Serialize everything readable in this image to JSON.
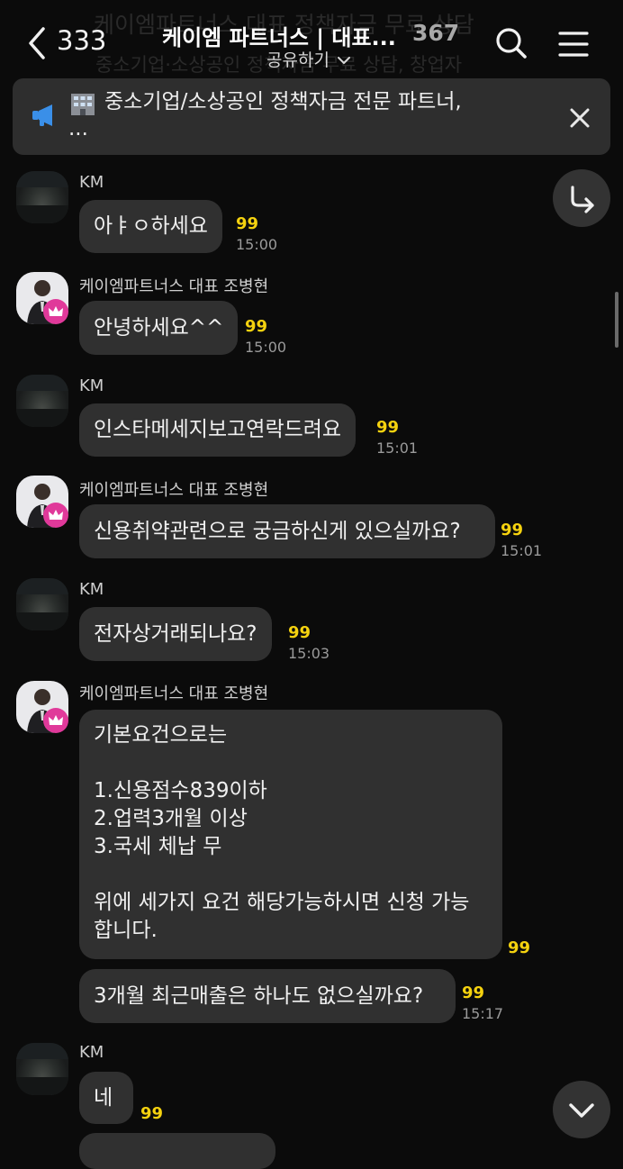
{
  "header": {
    "back_count": "333",
    "title": "케이엠 파트너스 | 대표...",
    "member_count": "367",
    "share_label": "공유하기",
    "bg_title_ghost": "케이엠파트너스 대표 정책자금 무료 상담",
    "bg_subtitle_ghost": "중소기업·소상공인 정책자금 무료 상담, 창업자"
  },
  "notice": {
    "line1": "중소기업/소상공인 정책자금 전문 파트너,",
    "line2": "..."
  },
  "messages": [
    {
      "sender": "KM",
      "text": "아ㅑㅇ하세요",
      "read": "99",
      "time": "15:00"
    },
    {
      "sender": "케이엠파트너스 대표 조병현",
      "text": "안녕하세요^^",
      "read": "99",
      "time": "15:00"
    },
    {
      "sender": "KM",
      "text": "인스타메세지보고연락드려요",
      "read": "99",
      "time": "15:01"
    },
    {
      "sender": "케이엠파트너스 대표 조병현",
      "text": "신용취약관련으로 궁금하신게 있으실까요?",
      "read": "99",
      "time": "15:01"
    },
    {
      "sender": "KM",
      "text": "전자상거래되나요?",
      "read": "99",
      "time": "15:03"
    },
    {
      "sender": "케이엠파트너스 대표 조병현",
      "text": "기본요건으로는\n\n1.신용점수839이하\n2.업력3개월 이상\n3.국세 체납 무\n\n위에 세가지 요건 해당가능하시면 신청 가능\n합니다.",
      "read": "99",
      "time": ""
    },
    {
      "sender": "",
      "text": "3개월 최근매출은 하나도 없으실까요?",
      "read": "99",
      "time": "15:17"
    },
    {
      "sender": "KM",
      "text": "네",
      "read": "99",
      "time": ""
    }
  ],
  "icons": {
    "back": "chevron-left-icon",
    "search": "search-icon",
    "menu": "menu-icon",
    "megaphone": "megaphone-icon",
    "building": "building-icon",
    "close": "close-icon",
    "share_arrow": "share-arrow-icon",
    "scroll_down": "chevron-down-icon",
    "crown": "crown-icon"
  },
  "colors": {
    "background": "#0b0b0b",
    "bubble": "#303030",
    "read_count": "#f5d20f",
    "crown_badge": "#e0399a",
    "megaphone": "#3a8fe8"
  }
}
